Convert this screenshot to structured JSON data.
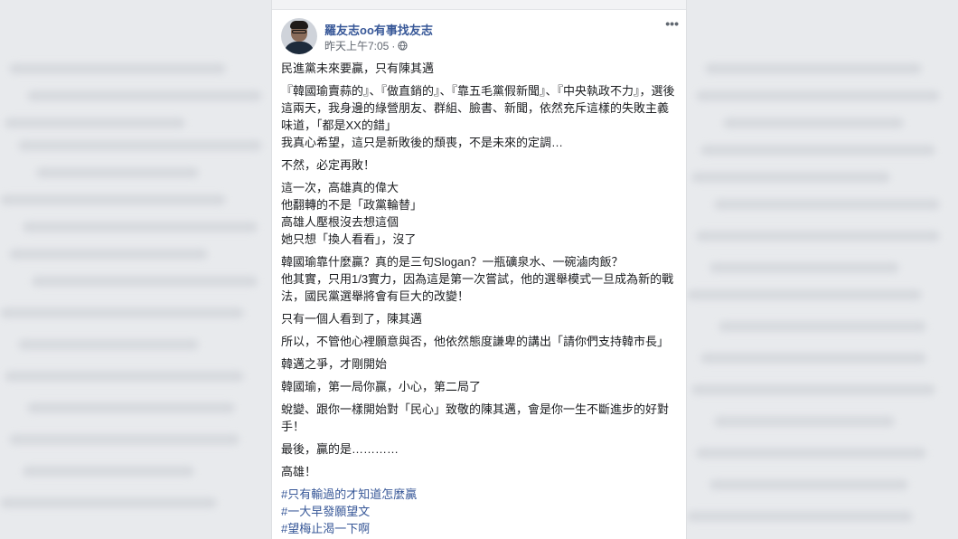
{
  "post": {
    "author": "羅友志oo有事找友志",
    "timestamp": "昨天上午7:05",
    "privacy_icon": "globe-icon",
    "more_label": "•••",
    "paragraphs": [
      "民進黨未來要贏，只有陳其邁",
      "『韓國瑜賣蒜的』、『做直銷的』、『靠五毛黨假新聞』、『中央執政不力』，選後這兩天，我身邊的綠營朋友、群組、臉書、新聞，依然充斥這樣的失敗主義味道，「都是XX的錯」\n我真心希望，這只是新敗後的頹喪，不是未來的定調…",
      "不然，必定再敗！",
      "這一次，高雄真的偉大\n他翻轉的不是「政黨輪替」\n高雄人壓根沒去想這個\n她只想「換人看看」，沒了",
      "韓國瑜靠什麼贏？真的是三句Slogan？一瓶礦泉水、一碗滷肉飯？\n他其實，只用1/3實力，因為這是第一次嘗試，他的選舉模式一旦成為新的戰法，國民黨選舉將會有巨大的改變！",
      "只有一個人看到了，陳其邁",
      "所以，不管他心裡願意與否，他依然態度謙卑的講出「請你們支持韓市長」",
      "韓邁之爭，才剛開始",
      "韓國瑜，第一局你贏，小心，第二局了",
      "蛻變、跟你一樣開始對「民心」致敬的陳其邁，會是你一生不斷進步的好對手！",
      "最後，贏的是…………",
      "高雄！"
    ],
    "hashtags": [
      "#只有輸過的才知道怎麼贏",
      "#一大早發願望文",
      "#望梅止渴一下啊"
    ]
  },
  "colors": {
    "link": "#385898",
    "text": "#1c1e21",
    "meta": "#616770",
    "background": "#e9ebee"
  }
}
